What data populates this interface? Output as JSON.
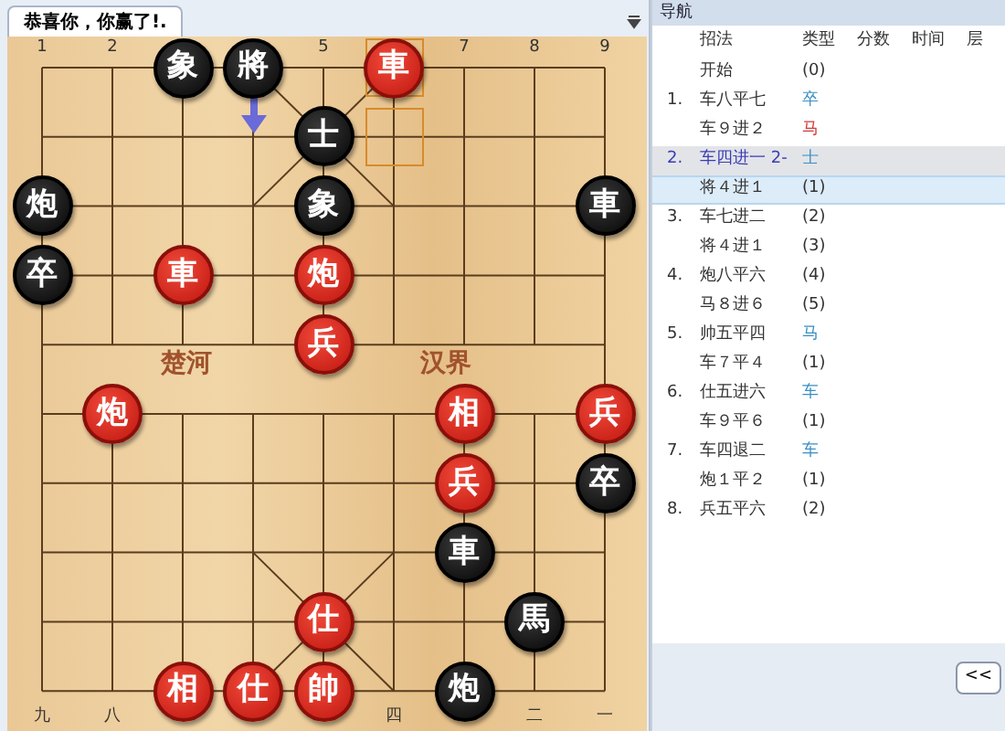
{
  "board_tab": {
    "title": "恭喜你，你赢了!."
  },
  "board": {
    "top_labels": [
      {
        "kind": "number",
        "text": "1"
      },
      {
        "kind": "number",
        "text": "2"
      },
      {
        "kind": "covered"
      },
      {
        "kind": "covered"
      },
      {
        "kind": "number",
        "text": "5"
      },
      {
        "kind": "covered"
      },
      {
        "kind": "number",
        "text": "7"
      },
      {
        "kind": "number",
        "text": "8"
      },
      {
        "kind": "number",
        "text": "9"
      }
    ],
    "bottom_labels": [
      {
        "kind": "number",
        "text": "九"
      },
      {
        "kind": "number",
        "text": "八"
      },
      {
        "kind": "covered"
      },
      {
        "kind": "covered"
      },
      {
        "kind": "covered"
      },
      {
        "kind": "number",
        "text": "四"
      },
      {
        "kind": "covered"
      },
      {
        "kind": "number",
        "text": "二"
      },
      {
        "kind": "number",
        "text": "一"
      }
    ],
    "river": [
      "楚河",
      "汉界"
    ],
    "ranks": [
      [
        {
          "kind": "empty"
        },
        {
          "kind": "empty"
        },
        {
          "label": "象",
          "kind": "black",
          "last_move": false,
          "arrow": false
        },
        {
          "label": "將",
          "kind": "black",
          "last_move": false,
          "arrow": true
        },
        {
          "kind": "empty"
        },
        {
          "label": "車",
          "kind": "red",
          "last_move": true,
          "arrow": false
        },
        {
          "kind": "empty"
        },
        {
          "kind": "empty"
        },
        {
          "kind": "empty"
        }
      ],
      [
        {
          "kind": "empty"
        },
        {
          "kind": "empty"
        },
        {
          "kind": "empty"
        },
        {
          "kind": "empty"
        },
        {
          "label": "士",
          "kind": "black",
          "last_move": false,
          "arrow": false
        },
        {
          "kind": "empty",
          "last_move": true
        },
        {
          "kind": "empty"
        },
        {
          "kind": "empty"
        },
        {
          "kind": "empty"
        }
      ],
      [
        {
          "label": "炮",
          "kind": "black",
          "last_move": false,
          "arrow": false
        },
        {
          "kind": "empty"
        },
        {
          "kind": "empty"
        },
        {
          "kind": "empty"
        },
        {
          "label": "象",
          "kind": "black",
          "last_move": false,
          "arrow": false
        },
        {
          "kind": "empty"
        },
        {
          "kind": "empty"
        },
        {
          "kind": "empty"
        },
        {
          "label": "車",
          "kind": "black",
          "last_move": false,
          "arrow": false
        }
      ],
      [
        {
          "label": "卒",
          "kind": "black",
          "last_move": false,
          "arrow": false
        },
        {
          "kind": "empty"
        },
        {
          "label": "車",
          "kind": "red",
          "last_move": false,
          "arrow": false
        },
        {
          "kind": "empty"
        },
        {
          "label": "炮",
          "kind": "red",
          "last_move": false,
          "arrow": false
        },
        {
          "kind": "empty"
        },
        {
          "kind": "empty"
        },
        {
          "kind": "empty"
        },
        {
          "kind": "empty"
        }
      ],
      [
        {
          "kind": "empty"
        },
        {
          "kind": "empty"
        },
        {
          "kind": "empty"
        },
        {
          "kind": "empty"
        },
        {
          "label": "兵",
          "kind": "red",
          "last_move": false,
          "arrow": false
        },
        {
          "kind": "empty"
        },
        {
          "kind": "empty"
        },
        {
          "kind": "empty"
        },
        {
          "kind": "empty"
        }
      ],
      [
        {
          "kind": "empty"
        },
        {
          "label": "炮",
          "kind": "red",
          "last_move": false,
          "arrow": false
        },
        {
          "kind": "empty"
        },
        {
          "kind": "empty"
        },
        {
          "kind": "empty"
        },
        {
          "kind": "empty"
        },
        {
          "label": "相",
          "kind": "red",
          "last_move": false,
          "arrow": false
        },
        {
          "kind": "empty"
        },
        {
          "label": "兵",
          "kind": "red",
          "last_move": false,
          "arrow": false
        }
      ],
      [
        {
          "kind": "empty"
        },
        {
          "kind": "empty"
        },
        {
          "kind": "empty"
        },
        {
          "kind": "empty"
        },
        {
          "kind": "empty"
        },
        {
          "kind": "empty"
        },
        {
          "label": "兵",
          "kind": "red",
          "last_move": false,
          "arrow": false
        },
        {
          "kind": "empty"
        },
        {
          "label": "卒",
          "kind": "black",
          "last_move": false,
          "arrow": false
        }
      ],
      [
        {
          "kind": "empty"
        },
        {
          "kind": "empty"
        },
        {
          "kind": "empty"
        },
        {
          "kind": "empty"
        },
        {
          "kind": "empty"
        },
        {
          "kind": "empty"
        },
        {
          "label": "車",
          "kind": "black",
          "last_move": false,
          "arrow": false
        },
        {
          "kind": "empty"
        },
        {
          "kind": "empty"
        }
      ],
      [
        {
          "kind": "empty"
        },
        {
          "kind": "empty"
        },
        {
          "kind": "empty"
        },
        {
          "kind": "empty"
        },
        {
          "label": "仕",
          "kind": "red",
          "last_move": false,
          "arrow": false
        },
        {
          "kind": "empty"
        },
        {
          "kind": "empty"
        },
        {
          "label": "馬",
          "kind": "black",
          "last_move": false,
          "arrow": false
        },
        {
          "kind": "empty"
        }
      ],
      [
        {
          "kind": "empty"
        },
        {
          "kind": "empty"
        },
        {
          "label": "相",
          "kind": "red",
          "last_move": false,
          "arrow": false
        },
        {
          "label": "仕",
          "kind": "red",
          "last_move": false,
          "arrow": false
        },
        {
          "label": "帥",
          "kind": "red",
          "last_move": false,
          "arrow": false
        },
        {
          "kind": "empty"
        },
        {
          "label": "炮",
          "kind": "black",
          "last_move": false,
          "arrow": false
        },
        {
          "kind": "empty"
        },
        {
          "kind": "empty"
        }
      ]
    ]
  },
  "navigation": {
    "title": "导航",
    "columns": [
      "招法",
      "类型",
      "分数",
      "时间",
      "层"
    ],
    "rows": [
      {
        "move": "开始",
        "type": "(0)",
        "selected": false,
        "focused": false
      },
      {
        "number": "1.",
        "move": "车八平七",
        "type": "卒",
        "color": "#3b8fc4",
        "selected": false,
        "focused": false
      },
      {
        "move": "车９进２",
        "type": "马",
        "color": "#d0393b",
        "selected": false,
        "focused": false
      },
      {
        "number": "2.",
        "move": "车四进一 2-",
        "type": "士",
        "color": "#3b8fc4",
        "selected": true,
        "focused": false
      },
      {
        "move": "将４进１",
        "type": "(1)",
        "selected": false,
        "focused": true
      },
      {
        "number": "3.",
        "move": "车七进二",
        "type": "(2)",
        "selected": false,
        "focused": false
      },
      {
        "move": "将４进１",
        "type": "(3)",
        "selected": false,
        "focused": false
      },
      {
        "number": "4.",
        "move": "炮八平六",
        "type": "(4)",
        "selected": false,
        "focused": false
      },
      {
        "move": "马８进６",
        "type": "(5)",
        "selected": false,
        "focused": false
      },
      {
        "number": "5.",
        "move": "帅五平四",
        "type": "马",
        "color": "#3b8fc4",
        "selected": false,
        "focused": false
      },
      {
        "move": "车７平４",
        "type": "(1)",
        "selected": false,
        "focused": false
      },
      {
        "number": "6.",
        "move": "仕五进六",
        "type": "车",
        "color": "#3b8fc4",
        "selected": false,
        "focused": false
      },
      {
        "move": "车９平６",
        "type": "(1)",
        "selected": false,
        "focused": false
      },
      {
        "number": "7.",
        "move": "车四退二",
        "type": "车",
        "color": "#3b8fc4",
        "selected": false,
        "focused": false
      },
      {
        "move": "炮１平２",
        "type": "(1)",
        "selected": false,
        "focused": false
      },
      {
        "number": "8.",
        "move": "兵五平六",
        "type": "(2)",
        "selected": false,
        "focused": false
      }
    ],
    "buttons": [
      "<<"
    ]
  }
}
